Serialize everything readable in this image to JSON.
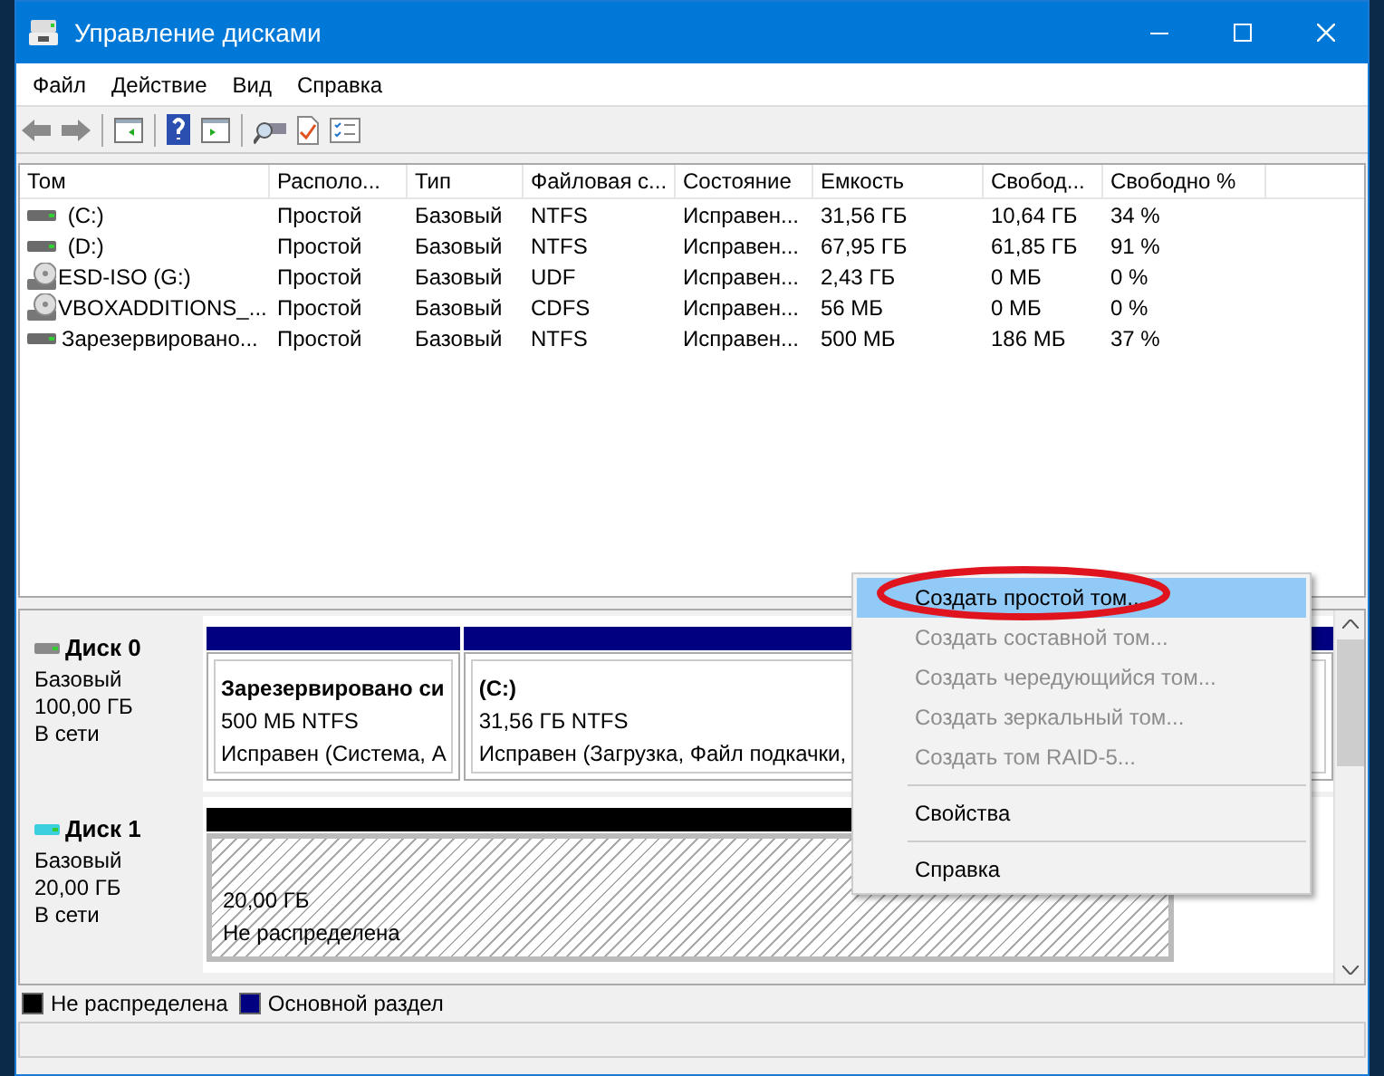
{
  "window": {
    "title": "Управление дисками"
  },
  "menu": [
    "Файл",
    "Действие",
    "Вид",
    "Справка"
  ],
  "volumes": {
    "columns": [
      "Том",
      "Располо...",
      "Тип",
      "Файловая с...",
      "Состояние",
      "Емкость",
      "Свобод...",
      "Свободно %"
    ],
    "rows": [
      {
        "kind": "hdd",
        "cells": [
          " (C:)",
          "Простой",
          "Базовый",
          "NTFS",
          "Исправен...",
          "31,56 ГБ",
          "10,64 ГБ",
          "34 %"
        ]
      },
      {
        "kind": "hdd",
        "cells": [
          " (D:)",
          "Простой",
          "Базовый",
          "NTFS",
          "Исправен...",
          "67,95 ГБ",
          "61,85 ГБ",
          "91 %"
        ]
      },
      {
        "kind": "cd",
        "cells": [
          "ESD-ISO (G:)",
          "Простой",
          "Базовый",
          "UDF",
          "Исправен...",
          "2,43 ГБ",
          "0 МБ",
          "0 %"
        ]
      },
      {
        "kind": "cd",
        "cells": [
          "VBOXADDITIONS_...",
          "Простой",
          "Базовый",
          "CDFS",
          "Исправен...",
          "56 МБ",
          "0 МБ",
          "0 %"
        ]
      },
      {
        "kind": "hdd",
        "cells": [
          "Зарезервировано...",
          "Простой",
          "Базовый",
          "NTFS",
          "Исправен...",
          "500 МБ",
          "186 МБ",
          "37 %"
        ]
      }
    ]
  },
  "disks": [
    {
      "name": "Диск 0",
      "color": "#8a8a8a",
      "type": "Базовый",
      "size": "100,00 ГБ",
      "status": "В сети",
      "partitions": [
        {
          "kind": "primary",
          "name": "Зарезервировано си",
          "size": "500 МБ NTFS",
          "status": "Исправен (Система, А"
        },
        {
          "kind": "primary",
          "name": "(C:)",
          "size": "31,56 ГБ NTFS",
          "status": "Исправен (Загрузка, Файл подкачки,"
        }
      ]
    },
    {
      "name": "Диск 1",
      "color": "#3ccfe0",
      "type": "Базовый",
      "size": "20,00 ГБ",
      "status": "В сети",
      "partitions": [
        {
          "kind": "unallocated",
          "size": "20,00 ГБ",
          "status": "Не распределена"
        }
      ]
    }
  ],
  "legend": [
    {
      "label": "Не распределена",
      "color": "#000000"
    },
    {
      "label": "Основной раздел",
      "color": "#000080"
    }
  ],
  "context_menu": [
    {
      "kind": "item",
      "label": "Создать простой том...",
      "disabled": false,
      "selected": true
    },
    {
      "kind": "item",
      "label": "Создать составной том...",
      "disabled": true,
      "selected": false
    },
    {
      "kind": "item",
      "label": "Создать чередующийся том...",
      "disabled": true,
      "selected": false
    },
    {
      "kind": "item",
      "label": "Создать зеркальный том...",
      "disabled": true,
      "selected": false
    },
    {
      "kind": "item",
      "label": "Создать том RAID-5...",
      "disabled": true,
      "selected": false
    },
    {
      "kind": "separator"
    },
    {
      "kind": "item",
      "label": "Свойства",
      "disabled": false,
      "selected": false
    },
    {
      "kind": "separator"
    },
    {
      "kind": "item",
      "label": "Справка",
      "disabled": false,
      "selected": false
    }
  ]
}
